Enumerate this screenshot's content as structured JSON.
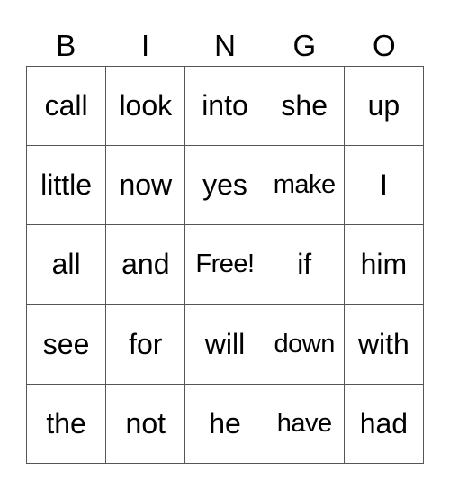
{
  "header": [
    "B",
    "I",
    "N",
    "G",
    "O"
  ],
  "cells": [
    [
      "call",
      "look",
      "into",
      "she",
      "up"
    ],
    [
      "little",
      "now",
      "yes",
      "make",
      "I"
    ],
    [
      "all",
      "and",
      "Free!",
      "if",
      "him"
    ],
    [
      "see",
      "for",
      "will",
      "down",
      "with"
    ],
    [
      "the",
      "not",
      "he",
      "have",
      "had"
    ]
  ]
}
